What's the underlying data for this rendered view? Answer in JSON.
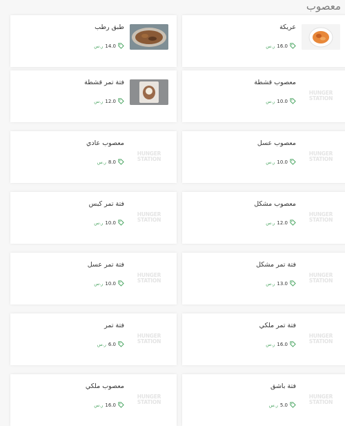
{
  "section": {
    "title": "معصوب"
  },
  "brand_placeholder": {
    "line1": "HUNGER",
    "line2": "STATION"
  },
  "currency": "ر.س",
  "colors": {
    "price_accent": "#4aa562",
    "text": "#333333",
    "placeholder_logo": "#e4e4e4"
  },
  "rows": [
    {
      "right": {
        "name": "عريكة",
        "price": "16.0",
        "image": "photo-ariqa"
      },
      "left": {
        "name": "طبق رطب",
        "price": "14.0",
        "image": "photo-rotab"
      }
    },
    {
      "right": {
        "name": "معصوب قشطة",
        "price": "10.0",
        "image": "hungerstation-logo"
      },
      "left": {
        "name": "فتة تمر قشطة",
        "price": "12.0",
        "image": "photo-qashta"
      }
    },
    {
      "right": {
        "name": "معصوب عسل",
        "price": "10.0",
        "image": "hungerstation-logo"
      },
      "left": {
        "name": "معصوب عادي",
        "price": "8.0",
        "image": "hungerstation-logo"
      }
    },
    {
      "right": {
        "name": "معصوب مشكل",
        "price": "12.0",
        "image": "hungerstation-logo"
      },
      "left": {
        "name": "فتة تمر كبس",
        "price": "10.0",
        "image": "hungerstation-logo"
      }
    },
    {
      "right": {
        "name": "فتة تمر مشكل",
        "price": "13.0",
        "image": "hungerstation-logo"
      },
      "left": {
        "name": "فتة تمر عسل",
        "price": "10.0",
        "image": "hungerstation-logo"
      }
    },
    {
      "right": {
        "name": "فتة تمر ملكي",
        "price": "16.0",
        "image": "hungerstation-logo"
      },
      "left": {
        "name": "فتة تمر",
        "price": "6.0",
        "image": "hungerstation-logo"
      }
    },
    {
      "right": {
        "name": "فتة باشق",
        "price": "5.0",
        "image": "hungerstation-logo"
      },
      "left": {
        "name": "معصوب ملكي",
        "price": "16.0",
        "image": "hungerstation-logo"
      }
    }
  ]
}
